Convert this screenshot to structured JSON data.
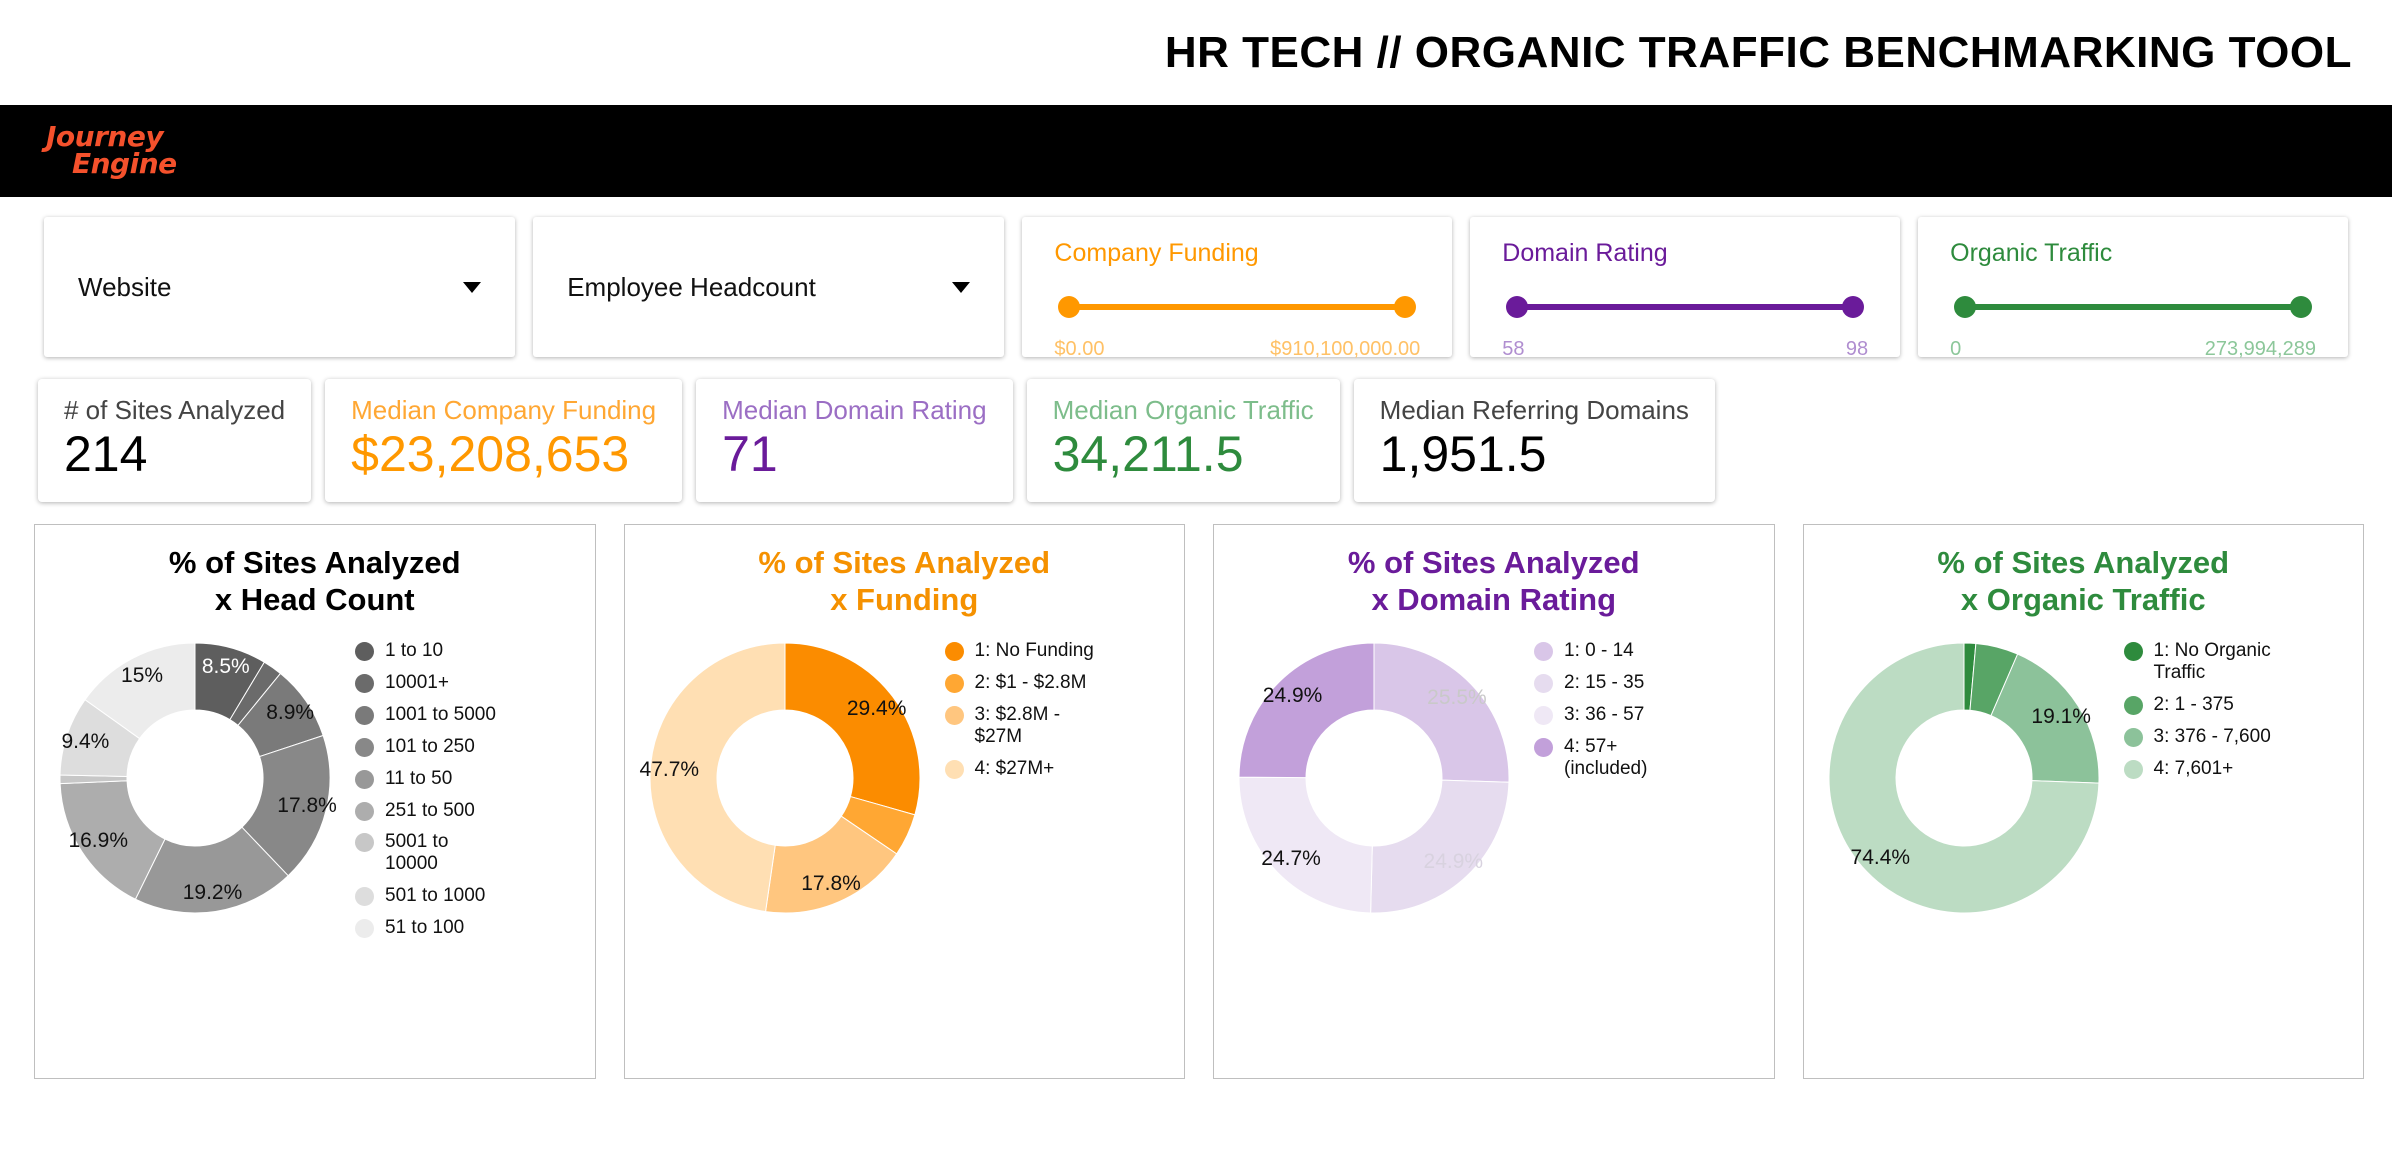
{
  "header": {
    "title": "HR TECH // ORGANIC TRAFFIC BENCHMARKING TOOL",
    "logo_line1": "Journey",
    "logo_line2": "Engine",
    "logo_color": "#f4512c",
    "bar_color": "#000000"
  },
  "colors": {
    "orange": "#ff9800",
    "orange_text": "#f59100",
    "purple": "#6a1b9a",
    "purple_light": "#9b6ec4",
    "green": "#2e8b3d",
    "green_light": "#7dbd8b",
    "neutral": "#333333"
  },
  "filters": {
    "selects": [
      {
        "name": "website",
        "value": "Website"
      },
      {
        "name": "employee-headcount",
        "value": "Employee Headcount"
      }
    ],
    "sliders": [
      {
        "name": "company-funding",
        "label": "Company Funding",
        "min_label": "$0.00",
        "max_label": "$910,100,000.00",
        "color": "#ff9800",
        "end_text_color": "#ffc166"
      },
      {
        "name": "domain-rating",
        "label": "Domain Rating",
        "min_label": "58",
        "max_label": "98",
        "color": "#6a1b9a",
        "end_text_color": "#b08ed0"
      },
      {
        "name": "organic-traffic",
        "label": "Organic Traffic",
        "min_label": "0",
        "max_label": "273,994,289",
        "color": "#2e8b3d",
        "end_text_color": "#8cc79a"
      }
    ]
  },
  "kpis": [
    {
      "name": "sites-analyzed",
      "label": "# of Sites Analyzed",
      "value": "214",
      "label_color": "#444444",
      "value_color": "#000000"
    },
    {
      "name": "median-company-funding",
      "label": "Median Company Funding",
      "value": "$23,208,653",
      "label_color": "#ffa733",
      "value_color": "#ff9800"
    },
    {
      "name": "median-domain-rating",
      "label": "Median Domain Rating",
      "value": "71",
      "label_color": "#9b6ec4",
      "value_color": "#6a1b9a"
    },
    {
      "name": "median-organic-traffic",
      "label": "Median Organic Traffic",
      "value": "34,211.5",
      "label_color": "#7dbd8b",
      "value_color": "#2e8b3d"
    },
    {
      "name": "median-referring-domains",
      "label": "Median Referring Domains",
      "value": "1,951.5",
      "label_color": "#444444",
      "value_color": "#000000"
    }
  ],
  "chart_data": [
    {
      "name": "head-count",
      "type": "pie",
      "title": "% of Sites Analyzed\nx Head Count",
      "title_color": "#000000",
      "categories": [
        "1 to 10",
        "10001+",
        "1001 to 5000",
        "101 to 250",
        "11 to 50",
        "251 to 500",
        "5001 to\n10000",
        "501 to 1000",
        "51 to 100"
      ],
      "values": [
        8.5,
        2.3,
        8.9,
        17.8,
        19.2,
        16.9,
        1.0,
        9.4,
        15.0
      ],
      "labels": [
        "8.5%",
        "",
        "8.9%",
        "17.8%",
        "19.2%",
        "16.9%",
        "",
        "9.4%",
        "15%"
      ],
      "label_colors": [
        "#ffffff",
        "",
        "#111111",
        "#111111",
        "#111111",
        "#111111",
        "",
        "#111111",
        "#111111"
      ],
      "colors": [
        "#5e5e5e",
        "#6b6b6b",
        "#7a7a7a",
        "#888888",
        "#989898",
        "#adadad",
        "#c7c7c7",
        "#dddddd",
        "#ececec"
      ],
      "legend_position": "right"
    },
    {
      "name": "funding",
      "type": "pie",
      "title": "% of Sites Analyzed\nx Funding",
      "title_color": "#f59100",
      "categories": [
        "1: No Funding",
        "2: $1 - $2.8M",
        "3: $2.8M -\n$27M",
        "4: $27M+"
      ],
      "values": [
        29.4,
        5.1,
        17.8,
        47.7
      ],
      "labels": [
        "29.4%",
        "",
        "17.8%",
        "47.7%"
      ],
      "label_colors": [
        "#111111",
        "",
        "#111111",
        "#111111"
      ],
      "colors": [
        "#fb8c00",
        "#ffa733",
        "#ffc67f",
        "#ffdfb3"
      ],
      "legend_position": "right"
    },
    {
      "name": "domain-rating",
      "type": "pie",
      "title": "% of Sites Analyzed\nx Domain Rating",
      "title_color": "#6a1b9a",
      "categories": [
        "1: 0 - 14",
        "2: 15 - 35",
        "3: 36 - 57",
        "4: 57+\n(included)"
      ],
      "values": [
        25.5,
        24.9,
        24.7,
        24.9
      ],
      "labels": [
        "25.5%",
        "24.9%",
        "24.7%",
        "24.9%"
      ],
      "label_colors": [
        "#c9c9c9",
        "#d8d2df",
        "#111111",
        "#111111"
      ],
      "colors": [
        "#d9c6e8",
        "#e6dcef",
        "#efe8f5",
        "#c2a0da"
      ],
      "legend_position": "right"
    },
    {
      "name": "organic-traffic",
      "type": "pie",
      "title": "% of Sites Analyzed\nx Organic Traffic",
      "title_color": "#2e8b3d",
      "categories": [
        "1: No Organic\nTraffic",
        "2: 1 - 375",
        "3: 376 - 7,600",
        "4: 7,601+"
      ],
      "values": [
        1.4,
        5.1,
        19.1,
        74.4
      ],
      "labels": [
        "",
        "",
        "19.1%",
        "74.4%"
      ],
      "label_colors": [
        "",
        "",
        "#111111",
        "#111111"
      ],
      "colors": [
        "#2e8b3d",
        "#58a566",
        "#8cc29a",
        "#bcdcc3"
      ],
      "legend_position": "right"
    }
  ]
}
